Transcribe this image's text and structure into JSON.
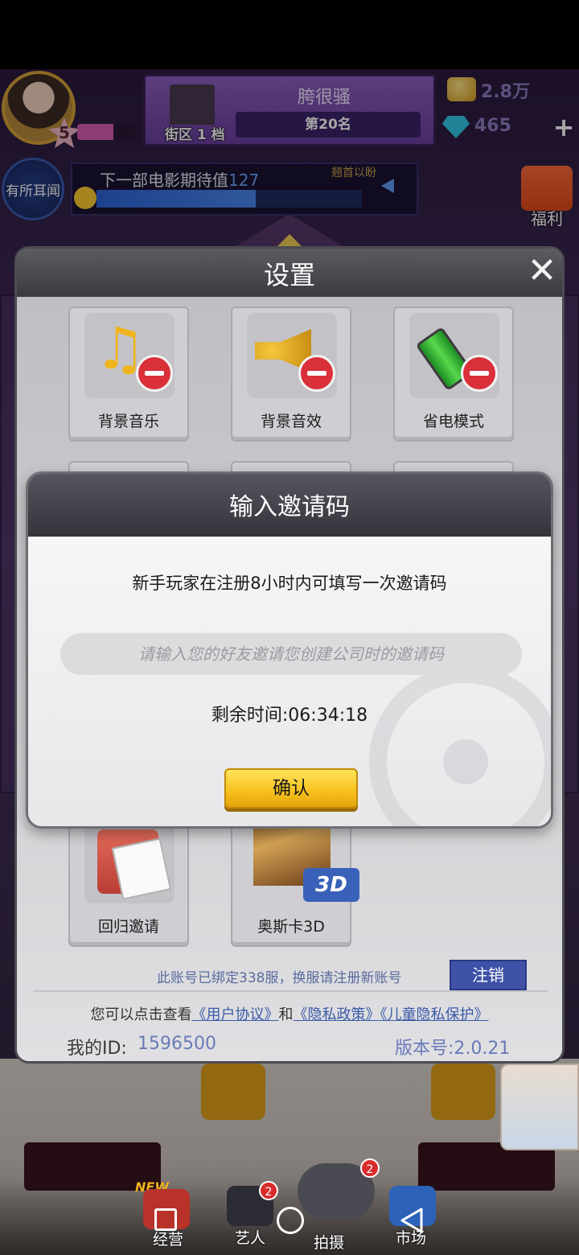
{
  "hud": {
    "player_level": "5",
    "district_label": "街区 1 档",
    "company_name": "胯很骚",
    "rank": "第20名",
    "gold": "2.8万",
    "diamonds": "465",
    "plus": "+",
    "news_button": "有所耳闻",
    "movie_expect_label": "下一部电影期待值",
    "movie_expect_value": "127",
    "movie_hint": "翘首以盼",
    "welfare_label": "福利"
  },
  "settings": {
    "title": "设置",
    "close": "✕",
    "tiles": [
      {
        "label": "背景音乐",
        "icon": "music-note-icon"
      },
      {
        "label": "背景音效",
        "icon": "sound-effect-icon"
      },
      {
        "label": "省电模式",
        "icon": "battery-icon"
      },
      {
        "label": "回归邀请",
        "icon": "invite-gift-icon"
      },
      {
        "label": "奥斯卡3D",
        "icon": "oscar-statue-icon"
      }
    ],
    "oscar_badge": "3D",
    "account_note": "此账号已绑定338服，换服请注册新账号",
    "logout_label": "注销",
    "legal": {
      "prefix": "您可以点击查看",
      "user_agreement": "《用户协议》",
      "and": "和",
      "privacy_policy": "《隐私政策》",
      "child_privacy": "《儿童隐私保护》"
    },
    "my_id_label": "我的ID:",
    "my_id_value": "1596500",
    "version": "版本号:2.0.21"
  },
  "invite_modal": {
    "title": "输入邀请码",
    "description": "新手玩家在注册8小时内可填写一次邀请码",
    "input_placeholder": "请输入您的好友邀请您创建公司时的邀请码",
    "input_value": "",
    "countdown": "剩余时间:06:34:18",
    "confirm_label": "确认"
  },
  "bottom_nav": {
    "new_tag": "NEW",
    "items": [
      {
        "label": "经营",
        "badge": ""
      },
      {
        "label": "艺人",
        "badge": "2"
      },
      {
        "label": "拍摄",
        "badge": "2"
      },
      {
        "label": "市场",
        "badge": ""
      }
    ]
  },
  "colors": {
    "accent_confirm": "#f7c01b",
    "logout_blue": "#3f52a7",
    "link_blue": "#3a5aa8"
  }
}
